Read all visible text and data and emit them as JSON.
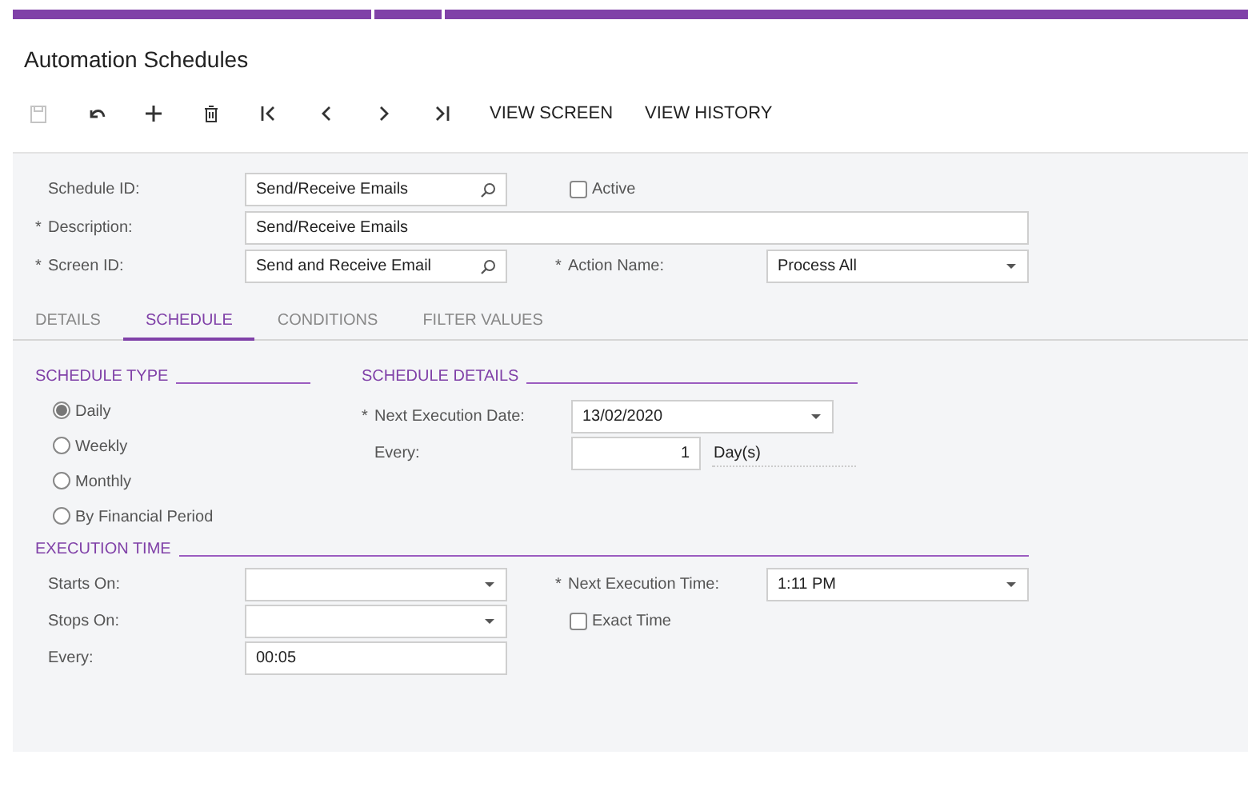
{
  "title": "Automation Schedules",
  "toolbar": {
    "icon_buttons": [
      {
        "kind": "save",
        "disabled": true
      },
      {
        "kind": "undo",
        "disabled": false
      },
      {
        "kind": "add",
        "disabled": false
      },
      {
        "kind": "delete",
        "disabled": false
      },
      {
        "kind": "first",
        "disabled": false
      },
      {
        "kind": "previous",
        "disabled": false
      },
      {
        "kind": "next",
        "disabled": false
      },
      {
        "kind": "last",
        "disabled": false
      }
    ],
    "text_buttons": [
      "VIEW SCREEN",
      "VIEW HISTORY"
    ]
  },
  "header": {
    "rows": [
      [
        {
          "label": "Schedule ID:",
          "kind": "lookup",
          "value": "Send/Receive Emails"
        },
        {
          "label": "Active",
          "kind": "checkbox",
          "checked": false
        }
      ],
      [
        {
          "mark": "*",
          "label": "Description:",
          "kind": "wide_text",
          "value": "Send/Receive Emails"
        }
      ],
      [
        {
          "mark": "*",
          "label": "Screen ID:",
          "kind": "lookup",
          "value": "Send and Receive Email"
        },
        {
          "mark": "*",
          "label": "Action Name:",
          "kind": "select",
          "value": "Process All"
        }
      ]
    ]
  },
  "tabs": [
    {
      "label": "DETAILS",
      "selected": false
    },
    {
      "label": "SCHEDULE",
      "selected": true
    },
    {
      "label": "CONDITIONS",
      "selected": false
    },
    {
      "label": "FILTER VALUES",
      "selected": false
    }
  ],
  "schedule_type": {
    "title": "SCHEDULE TYPE",
    "options": [
      {
        "label": "Daily",
        "selected": true
      },
      {
        "label": "Weekly",
        "selected": false
      },
      {
        "label": "Monthly",
        "selected": false
      },
      {
        "label": "By Financial Period",
        "selected": false
      }
    ]
  },
  "schedule_details": {
    "title": "SCHEDULE DETAILS",
    "fields": [
      {
        "mark": "*",
        "label": "Next Execution Date:",
        "kind": "select",
        "value": "13/02/2020"
      },
      {
        "label": "Every:",
        "kind": "number",
        "value": "1",
        "unit": "Day(s)"
      }
    ]
  },
  "execution_time": {
    "title": "EXECUTION TIME",
    "rows": [
      [
        {
          "label": "Starts On:",
          "kind": "select"
        },
        {
          "mark": "*",
          "label": "Next Execution Time:",
          "kind": "select",
          "value": "1:11 PM"
        }
      ],
      [
        {
          "label": "Stops On:",
          "kind": "select"
        },
        {
          "label": "Exact Time",
          "kind": "checkbox",
          "checked": false
        }
      ],
      [
        {
          "label": "Every:",
          "kind": "text",
          "value": "00:05"
        }
      ]
    ]
  }
}
